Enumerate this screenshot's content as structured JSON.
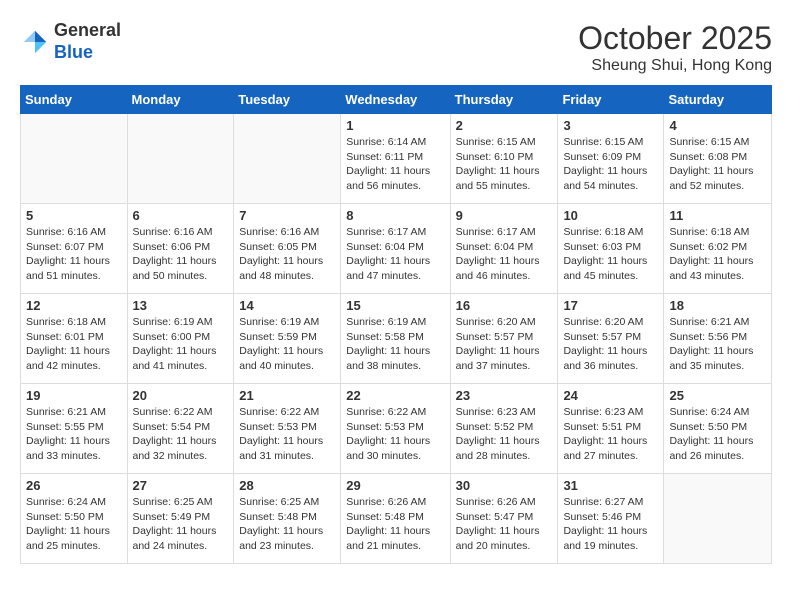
{
  "header": {
    "logo_line1": "General",
    "logo_line2": "Blue",
    "month": "October 2025",
    "location": "Sheung Shui, Hong Kong"
  },
  "weekdays": [
    "Sunday",
    "Monday",
    "Tuesday",
    "Wednesday",
    "Thursday",
    "Friday",
    "Saturday"
  ],
  "weeks": [
    [
      {
        "day": "",
        "info": ""
      },
      {
        "day": "",
        "info": ""
      },
      {
        "day": "",
        "info": ""
      },
      {
        "day": "1",
        "info": "Sunrise: 6:14 AM\nSunset: 6:11 PM\nDaylight: 11 hours and 56 minutes."
      },
      {
        "day": "2",
        "info": "Sunrise: 6:15 AM\nSunset: 6:10 PM\nDaylight: 11 hours and 55 minutes."
      },
      {
        "day": "3",
        "info": "Sunrise: 6:15 AM\nSunset: 6:09 PM\nDaylight: 11 hours and 54 minutes."
      },
      {
        "day": "4",
        "info": "Sunrise: 6:15 AM\nSunset: 6:08 PM\nDaylight: 11 hours and 52 minutes."
      }
    ],
    [
      {
        "day": "5",
        "info": "Sunrise: 6:16 AM\nSunset: 6:07 PM\nDaylight: 11 hours and 51 minutes."
      },
      {
        "day": "6",
        "info": "Sunrise: 6:16 AM\nSunset: 6:06 PM\nDaylight: 11 hours and 50 minutes."
      },
      {
        "day": "7",
        "info": "Sunrise: 6:16 AM\nSunset: 6:05 PM\nDaylight: 11 hours and 48 minutes."
      },
      {
        "day": "8",
        "info": "Sunrise: 6:17 AM\nSunset: 6:04 PM\nDaylight: 11 hours and 47 minutes."
      },
      {
        "day": "9",
        "info": "Sunrise: 6:17 AM\nSunset: 6:04 PM\nDaylight: 11 hours and 46 minutes."
      },
      {
        "day": "10",
        "info": "Sunrise: 6:18 AM\nSunset: 6:03 PM\nDaylight: 11 hours and 45 minutes."
      },
      {
        "day": "11",
        "info": "Sunrise: 6:18 AM\nSunset: 6:02 PM\nDaylight: 11 hours and 43 minutes."
      }
    ],
    [
      {
        "day": "12",
        "info": "Sunrise: 6:18 AM\nSunset: 6:01 PM\nDaylight: 11 hours and 42 minutes."
      },
      {
        "day": "13",
        "info": "Sunrise: 6:19 AM\nSunset: 6:00 PM\nDaylight: 11 hours and 41 minutes."
      },
      {
        "day": "14",
        "info": "Sunrise: 6:19 AM\nSunset: 5:59 PM\nDaylight: 11 hours and 40 minutes."
      },
      {
        "day": "15",
        "info": "Sunrise: 6:19 AM\nSunset: 5:58 PM\nDaylight: 11 hours and 38 minutes."
      },
      {
        "day": "16",
        "info": "Sunrise: 6:20 AM\nSunset: 5:57 PM\nDaylight: 11 hours and 37 minutes."
      },
      {
        "day": "17",
        "info": "Sunrise: 6:20 AM\nSunset: 5:57 PM\nDaylight: 11 hours and 36 minutes."
      },
      {
        "day": "18",
        "info": "Sunrise: 6:21 AM\nSunset: 5:56 PM\nDaylight: 11 hours and 35 minutes."
      }
    ],
    [
      {
        "day": "19",
        "info": "Sunrise: 6:21 AM\nSunset: 5:55 PM\nDaylight: 11 hours and 33 minutes."
      },
      {
        "day": "20",
        "info": "Sunrise: 6:22 AM\nSunset: 5:54 PM\nDaylight: 11 hours and 32 minutes."
      },
      {
        "day": "21",
        "info": "Sunrise: 6:22 AM\nSunset: 5:53 PM\nDaylight: 11 hours and 31 minutes."
      },
      {
        "day": "22",
        "info": "Sunrise: 6:22 AM\nSunset: 5:53 PM\nDaylight: 11 hours and 30 minutes."
      },
      {
        "day": "23",
        "info": "Sunrise: 6:23 AM\nSunset: 5:52 PM\nDaylight: 11 hours and 28 minutes."
      },
      {
        "day": "24",
        "info": "Sunrise: 6:23 AM\nSunset: 5:51 PM\nDaylight: 11 hours and 27 minutes."
      },
      {
        "day": "25",
        "info": "Sunrise: 6:24 AM\nSunset: 5:50 PM\nDaylight: 11 hours and 26 minutes."
      }
    ],
    [
      {
        "day": "26",
        "info": "Sunrise: 6:24 AM\nSunset: 5:50 PM\nDaylight: 11 hours and 25 minutes."
      },
      {
        "day": "27",
        "info": "Sunrise: 6:25 AM\nSunset: 5:49 PM\nDaylight: 11 hours and 24 minutes."
      },
      {
        "day": "28",
        "info": "Sunrise: 6:25 AM\nSunset: 5:48 PM\nDaylight: 11 hours and 23 minutes."
      },
      {
        "day": "29",
        "info": "Sunrise: 6:26 AM\nSunset: 5:48 PM\nDaylight: 11 hours and 21 minutes."
      },
      {
        "day": "30",
        "info": "Sunrise: 6:26 AM\nSunset: 5:47 PM\nDaylight: 11 hours and 20 minutes."
      },
      {
        "day": "31",
        "info": "Sunrise: 6:27 AM\nSunset: 5:46 PM\nDaylight: 11 hours and 19 minutes."
      },
      {
        "day": "",
        "info": ""
      }
    ]
  ]
}
